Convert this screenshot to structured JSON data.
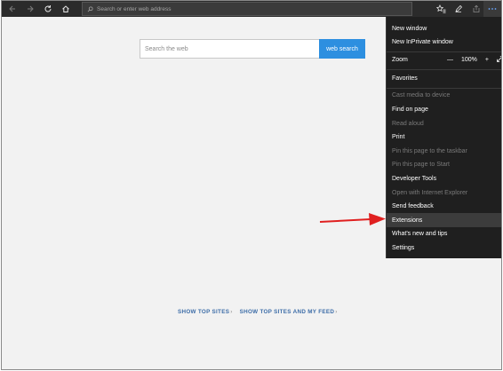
{
  "address_bar": {
    "placeholder": "Search or enter web address"
  },
  "search": {
    "placeholder": "Search the web",
    "button_label": "web search"
  },
  "top_sites": {
    "link1": "SHOW TOP SITES",
    "link2": "SHOW TOP SITES AND MY FEED",
    "chevron": "›"
  },
  "menu": {
    "new_window": "New window",
    "new_inprivate": "New InPrivate window",
    "zoom_label": "Zoom",
    "zoom_minus": "—",
    "zoom_value": "100%",
    "zoom_plus": "+",
    "favorites": "Favorites",
    "cast_media": "Cast media to device",
    "find_on_page": "Find on page",
    "read_aloud": "Read aloud",
    "print": "Print",
    "pin_taskbar": "Pin this page to the taskbar",
    "pin_start": "Pin this page to Start",
    "developer_tools": "Developer Tools",
    "open_ie": "Open with Internet Explorer",
    "send_feedback": "Send feedback",
    "extensions": "Extensions",
    "whats_new": "What's new and tips",
    "settings": "Settings"
  },
  "colors": {
    "accent": "#2d8fe0",
    "toolbar": "#2b2b2b",
    "menu_bg": "#1f1f1f",
    "arrow": "#e02020",
    "link": "#3d6da8"
  }
}
